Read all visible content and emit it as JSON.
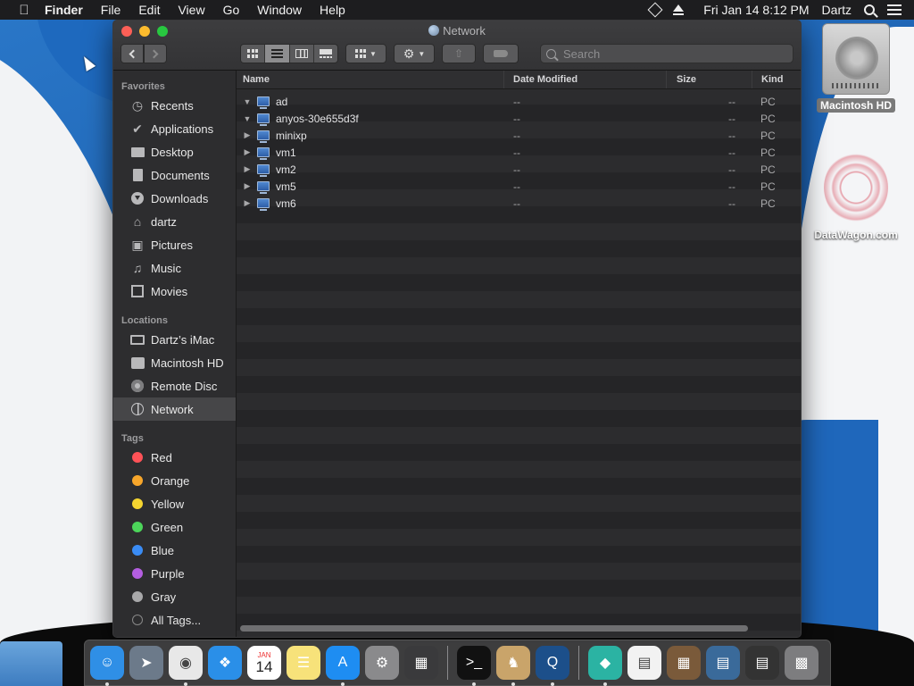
{
  "menubar": {
    "app_name": "Finder",
    "menus": [
      "File",
      "Edit",
      "View",
      "Go",
      "Window",
      "Help"
    ],
    "clock": "Fri Jan 14  8:12 PM",
    "user": "Dartz"
  },
  "desktop": {
    "icons": [
      {
        "label": "Macintosh HD",
        "icon": "hard-drive-icon"
      },
      {
        "label": "DataWagon.com",
        "icon": "datawagon-logo-icon"
      }
    ]
  },
  "window": {
    "title": "Network",
    "search_placeholder": "Search",
    "toolbar": {
      "view_modes": [
        "icon-view",
        "list-view",
        "column-view",
        "gallery-view"
      ],
      "active_view": "list-view"
    },
    "sidebar": {
      "favorites_header": "Favorites",
      "favorites": [
        {
          "label": "Recents",
          "icon": "clock-icon"
        },
        {
          "label": "Applications",
          "icon": "applications-icon"
        },
        {
          "label": "Desktop",
          "icon": "desktop-icon"
        },
        {
          "label": "Documents",
          "icon": "document-icon"
        },
        {
          "label": "Downloads",
          "icon": "download-icon"
        },
        {
          "label": "dartz",
          "icon": "home-icon"
        },
        {
          "label": "Pictures",
          "icon": "camera-icon"
        },
        {
          "label": "Music",
          "icon": "music-note-icon"
        },
        {
          "label": "Movies",
          "icon": "film-icon"
        }
      ],
      "locations_header": "Locations",
      "locations": [
        {
          "label": "Dartz’s iMac",
          "icon": "monitor-icon"
        },
        {
          "label": "Macintosh HD",
          "icon": "hard-drive-icon"
        },
        {
          "label": "Remote Disc",
          "icon": "disc-icon"
        },
        {
          "label": "Network",
          "icon": "globe-icon",
          "selected": true
        }
      ],
      "tags_header": "Tags",
      "tags": [
        {
          "label": "Red",
          "color": "#ff5257"
        },
        {
          "label": "Orange",
          "color": "#f7a62b"
        },
        {
          "label": "Yellow",
          "color": "#f5d530"
        },
        {
          "label": "Green",
          "color": "#4cd55a"
        },
        {
          "label": "Blue",
          "color": "#3a8cf5"
        },
        {
          "label": "Purple",
          "color": "#b45ee0"
        },
        {
          "label": "Gray",
          "color": "#a8a8aa"
        },
        {
          "label": "All Tags...",
          "color": ""
        }
      ]
    },
    "columns": {
      "name": "Name",
      "date": "Date Modified",
      "size": "Size",
      "kind": "Kind"
    },
    "rows": [
      {
        "name": "ad",
        "date": "--",
        "size": "--",
        "kind": "PC",
        "expanded": true
      },
      {
        "name": "anyos-30e655d3f",
        "date": "--",
        "size": "--",
        "kind": "PC",
        "expanded": true
      },
      {
        "name": "minixp",
        "date": "--",
        "size": "--",
        "kind": "PC",
        "expanded": false
      },
      {
        "name": "vm1",
        "date": "--",
        "size": "--",
        "kind": "PC",
        "expanded": false
      },
      {
        "name": "vm2",
        "date": "--",
        "size": "--",
        "kind": "PC",
        "expanded": false
      },
      {
        "name": "vm5",
        "date": "--",
        "size": "--",
        "kind": "PC",
        "expanded": false
      },
      {
        "name": "vm6",
        "date": "--",
        "size": "--",
        "kind": "PC",
        "expanded": false
      }
    ]
  },
  "dock": {
    "calendar_month": "JAN",
    "calendar_day": "14",
    "apps": [
      {
        "name": "Finder",
        "icon": "finder-icon",
        "color": "#2f8fe6",
        "running": true
      },
      {
        "name": "Launchpad",
        "icon": "rocket-icon",
        "color": "#6c7a8a",
        "running": false
      },
      {
        "name": "Chrome",
        "icon": "chrome-icon",
        "color": "#e8e8e8",
        "running": true
      },
      {
        "name": "Safari",
        "icon": "compass-icon",
        "color": "#2a8fe8",
        "running": false
      },
      {
        "name": "Calendar",
        "icon": "calendar-icon",
        "color": "#ffffff",
        "running": false
      },
      {
        "name": "Notes",
        "icon": "notes-icon",
        "color": "#f7e27a",
        "running": false
      },
      {
        "name": "App Store",
        "icon": "app-store-icon",
        "color": "#1e8df2",
        "running": true
      },
      {
        "name": "System Preferences",
        "icon": "gear-icon",
        "color": "#8a8a8c",
        "running": false
      },
      {
        "name": "Photo Viewer",
        "icon": "photo-icon",
        "color": "#3a3a3c",
        "running": false
      },
      {
        "name": "Terminal",
        "icon": "terminal-icon",
        "color": "#111111",
        "running": true
      },
      {
        "name": "Chess",
        "icon": "chess-icon",
        "color": "#c9a46a",
        "running": true
      },
      {
        "name": "QuickTime",
        "icon": "quicktime-icon",
        "color": "#1c4f8a",
        "running": true
      },
      {
        "name": "Network Tool",
        "icon": "diamond-icon",
        "color": "#2bb3a3",
        "running": true
      },
      {
        "name": "Archive",
        "icon": "zip-icon",
        "color": "#f2f2f2",
        "running": false
      },
      {
        "name": "Chess Board",
        "icon": "board-icon",
        "color": "#7a5a3a",
        "running": false
      },
      {
        "name": "Network Connect",
        "icon": "network-window-icon",
        "color": "#3a6a9a",
        "running": false
      },
      {
        "name": "Activity",
        "icon": "activity-icon",
        "color": "#333333",
        "running": false
      },
      {
        "name": "Trash",
        "icon": "trash-icon",
        "color": "#7d7d7f",
        "running": false
      }
    ]
  }
}
